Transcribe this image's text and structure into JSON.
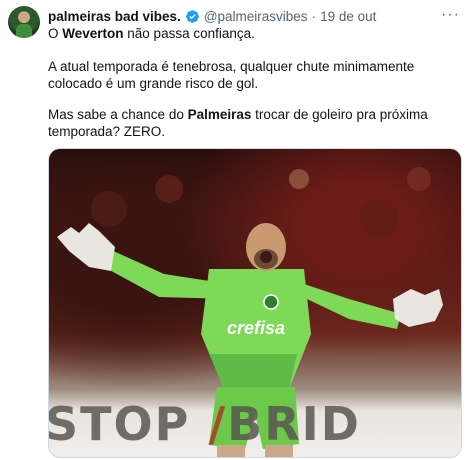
{
  "author": {
    "name": "palmeiras bad vibes.",
    "handle": "@palmeirasvibes",
    "separator": "·",
    "date": "19 de out"
  },
  "more_label": "···",
  "tweet": {
    "p1_pre": "O ",
    "p1_bold": "Weverton",
    "p1_post": " não passa confiança.",
    "p2": "A atual temporada é tenebrosa, qualquer chute minimamente colocado é um grande risco de gol.",
    "p3_pre": "Mas sabe a chance do ",
    "p3_bold": "Palmeiras",
    "p3_post": " trocar de goleiro pra próxima temporada? ZERO."
  },
  "photo": {
    "board_left": "STOP",
    "board_mid": "/",
    "board_right": "BRID",
    "shirt_text": "crefisa",
    "colors": {
      "kit": "#7ed957",
      "kit_shadow": "#4aa63a",
      "gloves": "#e9e6df",
      "board": "#f1efec"
    }
  },
  "colors": {
    "verified": "#1d9bf0",
    "secondary": "#536471"
  }
}
